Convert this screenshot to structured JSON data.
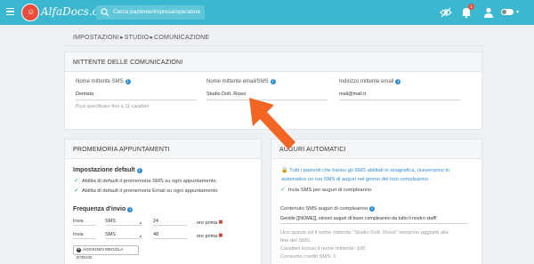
{
  "topbar": {
    "logo": "AlfaDocs.com",
    "search_placeholder": "Cerca paziente/impresa/operatore",
    "notification_count": "1",
    "accent": "#3bb8cf"
  },
  "breadcrumb": {
    "items": [
      "IMPOSTAZIONI",
      "STUDIO",
      "COMUNICAZIONE"
    ]
  },
  "sender_card": {
    "title": "MITTENTE DELLE COMUNICAZIONI",
    "sms_label": "Nome mittente SMS",
    "sms_value": "Dentista",
    "sms_hint": "Puoi specificare fino a 11 caratteri",
    "email_name_label": "Nome mittente email/SMS",
    "email_name_value": "Studio Dott. Rossi",
    "email_addr_label": "Indirizzo mittente email",
    "email_addr_value": "mail@mail.it"
  },
  "reminder_card": {
    "title": "PROMEMORIA APPUNTAMENTI",
    "default_heading": "Impostazione default",
    "checks": [
      "Abilita di default il promemoria SMS su ogni appuntamento",
      "Abilita di default il promemoria Email su ogni appuntamento"
    ],
    "frequency_heading": "Frequenza d'invio",
    "rows": [
      {
        "label": "Invia",
        "channel": "SMS",
        "value": "24",
        "unit": "ore prima"
      },
      {
        "label": "Invia",
        "channel": "SMS",
        "value": "48",
        "unit": "ore prima"
      }
    ],
    "add_button": "AGGIUNGI REGOLA D'INVIO"
  },
  "birthday_card": {
    "title": "AUGURI AUTOMATICI",
    "notice": "Tutti i pazienti che hanno gli SMS abilitati in anagrafica, riceveranno in automatico un tuo SMS di auguri nel giorno del loro compleanno",
    "check": "Invia SMS per auguri di compleanno",
    "content_label": "Contenuto SMS auguri di compleanno",
    "message": "Gentile [[NOME]], sinceri auguri di buon compleanno da tutto il nostro staff!",
    "note_line1": "Uno spazio ed il nome mittente \"Studio Dott. Rossi\" verranno aggiunti alla",
    "note_line2": "fine del SMS.",
    "note_line3": "Caratteri inclusi il nome mittente: 100",
    "note_line4": "Consumo crediti SMS: 1"
  },
  "colors": {
    "info_blue": "#2d8ed6",
    "check_green": "#27ae60",
    "remove_red": "#c0392b",
    "arrow_orange": "#f26522"
  }
}
